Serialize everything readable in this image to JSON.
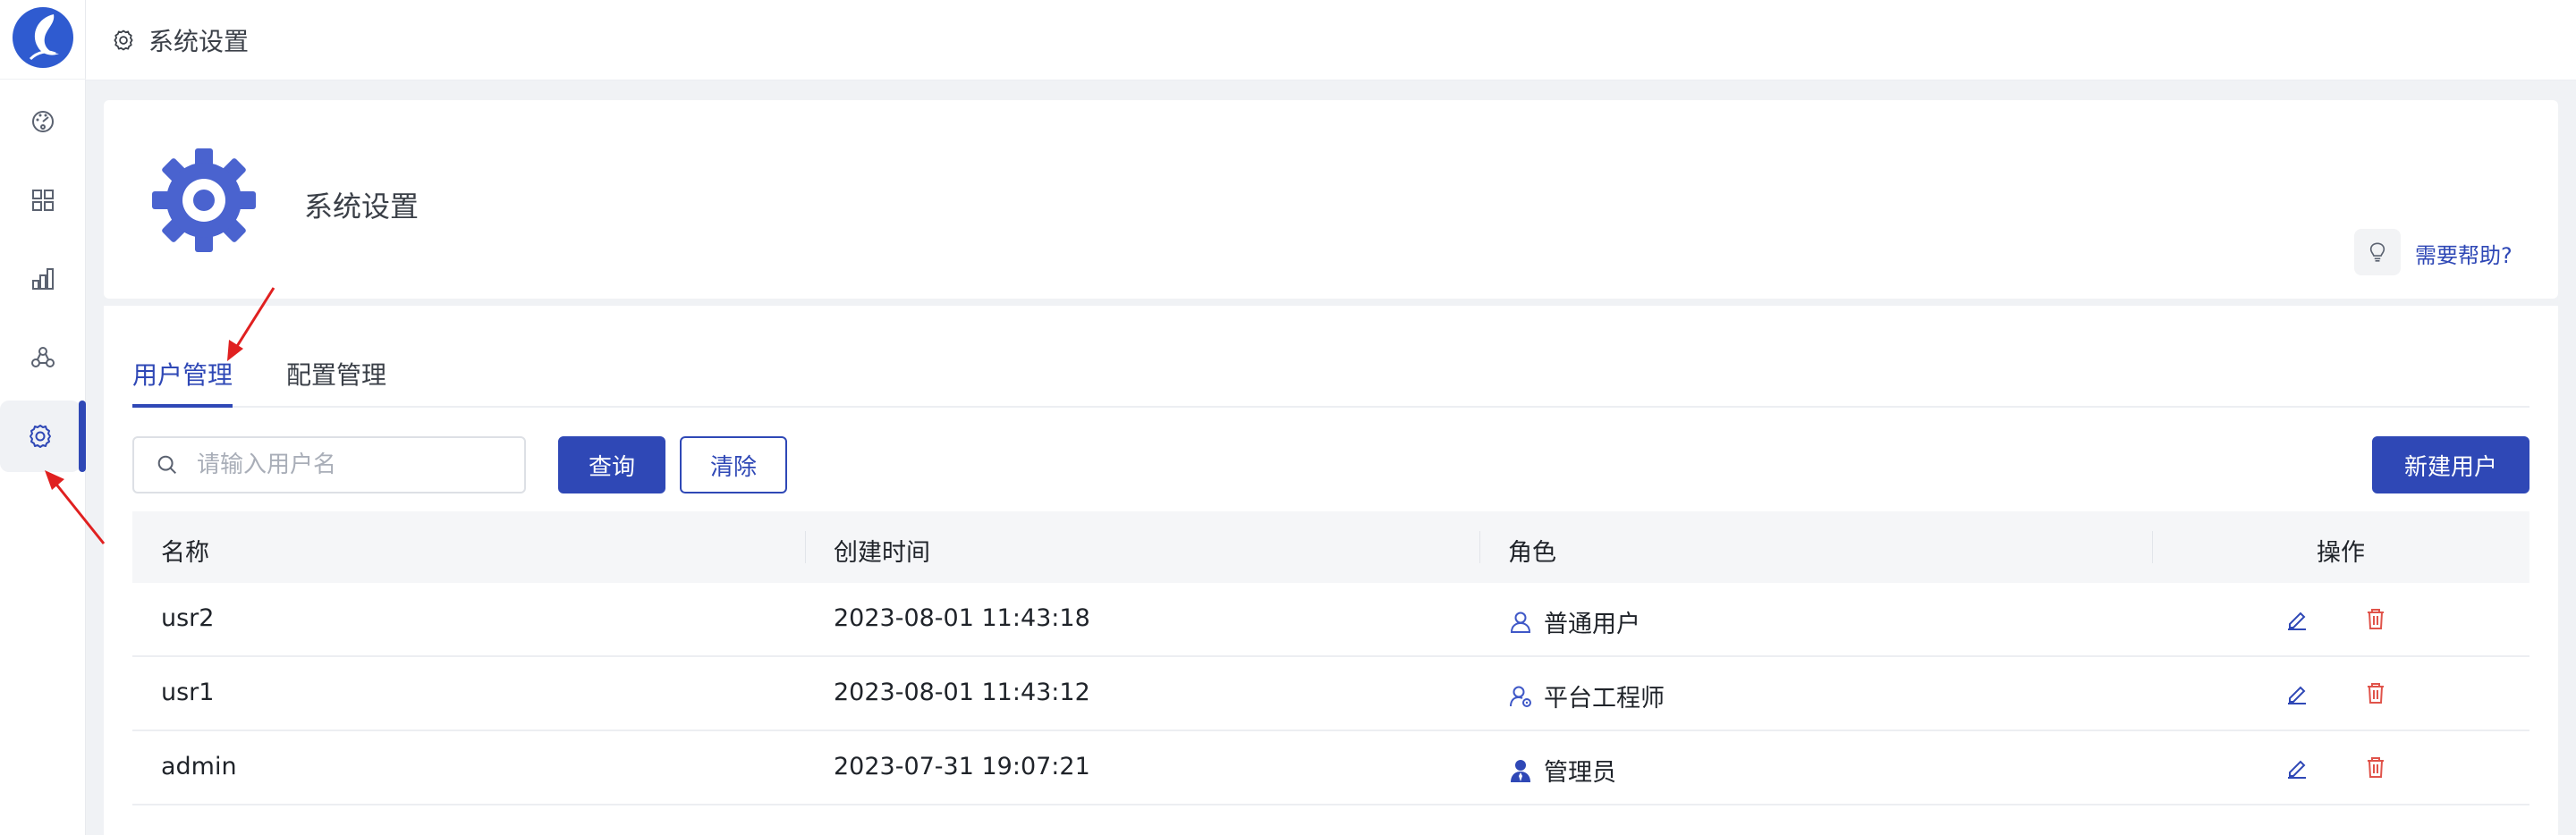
{
  "breadcrumb": {
    "title": "系统设置"
  },
  "header": {
    "title": "系统设置",
    "help_label": "需要帮助?"
  },
  "tabs": [
    {
      "label": "用户管理",
      "active": true
    },
    {
      "label": "配置管理",
      "active": false
    }
  ],
  "search": {
    "placeholder": "请输入用户名",
    "value": ""
  },
  "buttons": {
    "query": "查询",
    "clear": "清除",
    "new_user": "新建用户"
  },
  "table": {
    "columns": [
      "名称",
      "创建时间",
      "角色",
      "操作"
    ],
    "rows": [
      {
        "name": "usr2",
        "created": "2023-08-01 11:43:18",
        "role": "普通用户",
        "role_icon": "user-outline-icon"
      },
      {
        "name": "usr1",
        "created": "2023-08-01 11:43:12",
        "role": "平台工程师",
        "role_icon": "user-gear-icon"
      },
      {
        "name": "admin",
        "created": "2023-07-31 19:07:21",
        "role": "管理员",
        "role_icon": "admin-user-icon"
      }
    ]
  },
  "sidebar": {
    "items": [
      {
        "icon": "dashboard-icon"
      },
      {
        "icon": "apps-grid-icon"
      },
      {
        "icon": "bar-chart-icon"
      },
      {
        "icon": "cluster-icon"
      },
      {
        "icon": "settings-icon",
        "active": true
      }
    ]
  },
  "colors": {
    "accent": "#2f48b6",
    "danger": "#e0534a",
    "annotation": "#e02020"
  }
}
